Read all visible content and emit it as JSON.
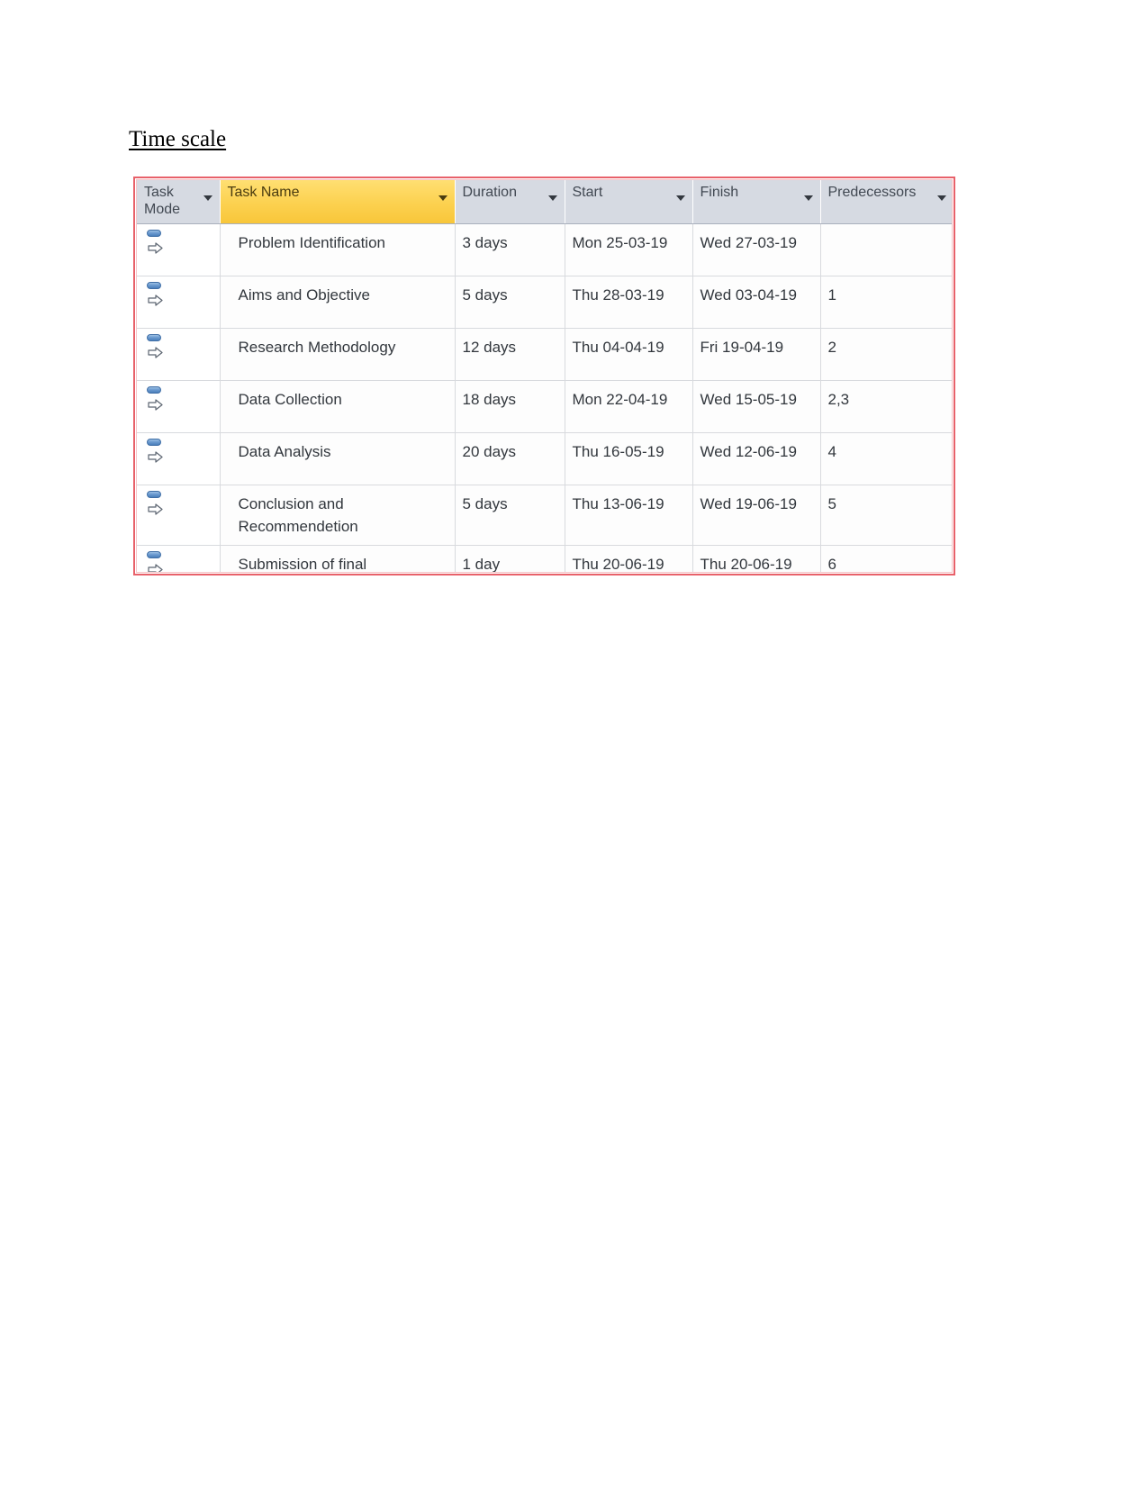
{
  "page": {
    "heading": "Time scale"
  },
  "table": {
    "columns": [
      {
        "id": "task_mode",
        "label": "Task Mode",
        "selected": false,
        "has_filter": true
      },
      {
        "id": "task_name",
        "label": "Task Name",
        "selected": true,
        "has_filter": true
      },
      {
        "id": "duration",
        "label": "Duration",
        "selected": false,
        "has_filter": true
      },
      {
        "id": "start",
        "label": "Start",
        "selected": false,
        "has_filter": true
      },
      {
        "id": "finish",
        "label": "Finish",
        "selected": false,
        "has_filter": true
      },
      {
        "id": "predecessors",
        "label": "Predecessors",
        "selected": false,
        "has_filter": true
      }
    ],
    "rows": [
      {
        "task_mode_icon": "auto-scheduled-icon",
        "task_name": "Problem Identification",
        "duration": "3 days",
        "start": "Mon 25-03-19",
        "finish": "Wed 27-03-19",
        "predecessors": ""
      },
      {
        "task_mode_icon": "auto-scheduled-icon",
        "task_name": "Aims and Objective",
        "duration": "5 days",
        "start": "Thu 28-03-19",
        "finish": "Wed 03-04-19",
        "predecessors": "1"
      },
      {
        "task_mode_icon": "auto-scheduled-icon",
        "task_name": "Research Methodology",
        "duration": "12 days",
        "start": "Thu 04-04-19",
        "finish": "Fri 19-04-19",
        "predecessors": "2"
      },
      {
        "task_mode_icon": "auto-scheduled-icon",
        "task_name": "Data Collection",
        "duration": "18 days",
        "start": "Mon 22-04-19",
        "finish": "Wed 15-05-19",
        "predecessors": "2,3"
      },
      {
        "task_mode_icon": "auto-scheduled-icon",
        "task_name": "Data Analysis",
        "duration": "20 days",
        "start": "Thu 16-05-19",
        "finish": "Wed 12-06-19",
        "predecessors": "4"
      },
      {
        "task_mode_icon": "auto-scheduled-icon",
        "task_name": "Conclusion and\nRecommendetion",
        "duration": "5 days",
        "start": "Thu 13-06-19",
        "finish": "Wed 19-06-19",
        "predecessors": "5"
      },
      {
        "task_mode_icon": "auto-scheduled-icon",
        "task_name": "Submission of final\nReport",
        "duration": "1 day",
        "start": "Thu 20-06-19",
        "finish": "Thu 20-06-19",
        "predecessors": "6"
      }
    ]
  },
  "colors": {
    "frame_border": "#e8616a",
    "header_background": "#d6dae2",
    "selected_column_background": "#fcd14f",
    "grid_line": "#d8dade",
    "task_mode_icon_blue": "#4a7fbb"
  }
}
